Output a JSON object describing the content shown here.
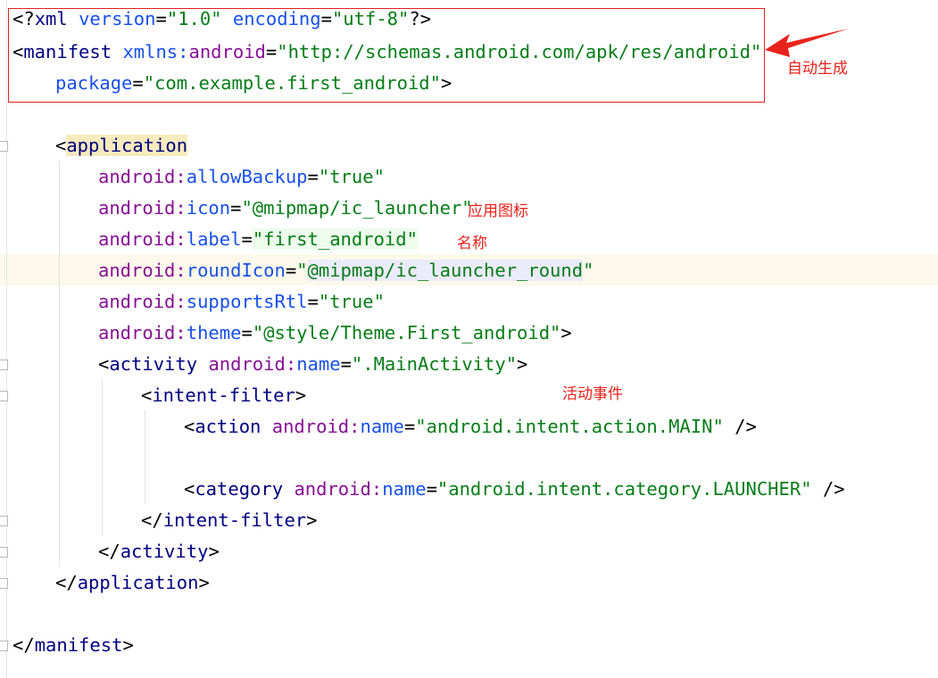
{
  "code": {
    "xml_decl": {
      "open": "<?",
      "name": "xml",
      "version_attr": "version",
      "version_val": "\"1.0\"",
      "encoding_attr": "encoding",
      "encoding_val": "\"utf-8\"",
      "close": "?>"
    },
    "manifest_open": {
      "bracket": "<",
      "tag": "manifest",
      "ns": "xmlns:",
      "attr": "android",
      "eq": "=",
      "val": "\"http://schemas.android.com/apk/res/android\""
    },
    "package_line": {
      "attr": "package",
      "eq": "=",
      "val": "\"com.example.first_android\"",
      "close": ">"
    },
    "application_open": {
      "bracket": "<",
      "tag": "application"
    },
    "attrs": [
      {
        "ns": "android:",
        "name": "allowBackup",
        "eq": "=",
        "val": "\"true\""
      },
      {
        "ns": "android:",
        "name": "icon",
        "eq": "=",
        "val": "\"@mipmap/ic_launcher\""
      },
      {
        "ns": "android:",
        "name": "label",
        "eq": "=",
        "val": "\"first_android\""
      },
      {
        "ns": "android:",
        "name": "roundIcon",
        "eq": "=",
        "val_q": "\"",
        "val": "@mipmap/ic_launcher_round",
        "val_end": "\""
      },
      {
        "ns": "android:",
        "name": "supportsRtl",
        "eq": "=",
        "val": "\"true\""
      },
      {
        "ns": "android:",
        "name": "theme",
        "eq": "=",
        "val": "\"@style/Theme.First_android\"",
        "close": ">"
      }
    ],
    "activity_open": {
      "bracket": "<",
      "tag": "activity",
      "ns": "android:",
      "attr": "name",
      "eq": "=",
      "val": "\".MainActivity\"",
      "close": ">"
    },
    "intent_filter_open": {
      "bracket": "<",
      "tag": "intent-filter",
      "close": ">"
    },
    "action": {
      "bracket": "<",
      "tag": "action",
      "ns": "android:",
      "attr": "name",
      "eq": "=",
      "val": "\"android.intent.action.MAIN\"",
      "close": " />"
    },
    "category": {
      "bracket": "<",
      "tag": "category",
      "ns": "android:",
      "attr": "name",
      "eq": "=",
      "val": "\"android.intent.category.LAUNCHER\"",
      "close": " />"
    },
    "intent_filter_close": {
      "bracket": "</",
      "tag": "intent-filter",
      "close": ">"
    },
    "activity_close": {
      "bracket": "</",
      "tag": "activity",
      "close": ">"
    },
    "application_close": {
      "bracket": "</",
      "tag": "application",
      "close": ">"
    },
    "manifest_close": {
      "bracket": "</",
      "tag": "manifest",
      "close": ">"
    }
  },
  "annotations": {
    "auto_generated": "自动生成",
    "app_icon": "应用图标",
    "name": "名称",
    "activity_event": "活动事件"
  },
  "colors": {
    "annotation_red": "#e8231b",
    "tag_blue": "#000080",
    "namespace_purple": "#871094",
    "attribute_blue": "#1750eb",
    "value_green": "#067d17"
  }
}
